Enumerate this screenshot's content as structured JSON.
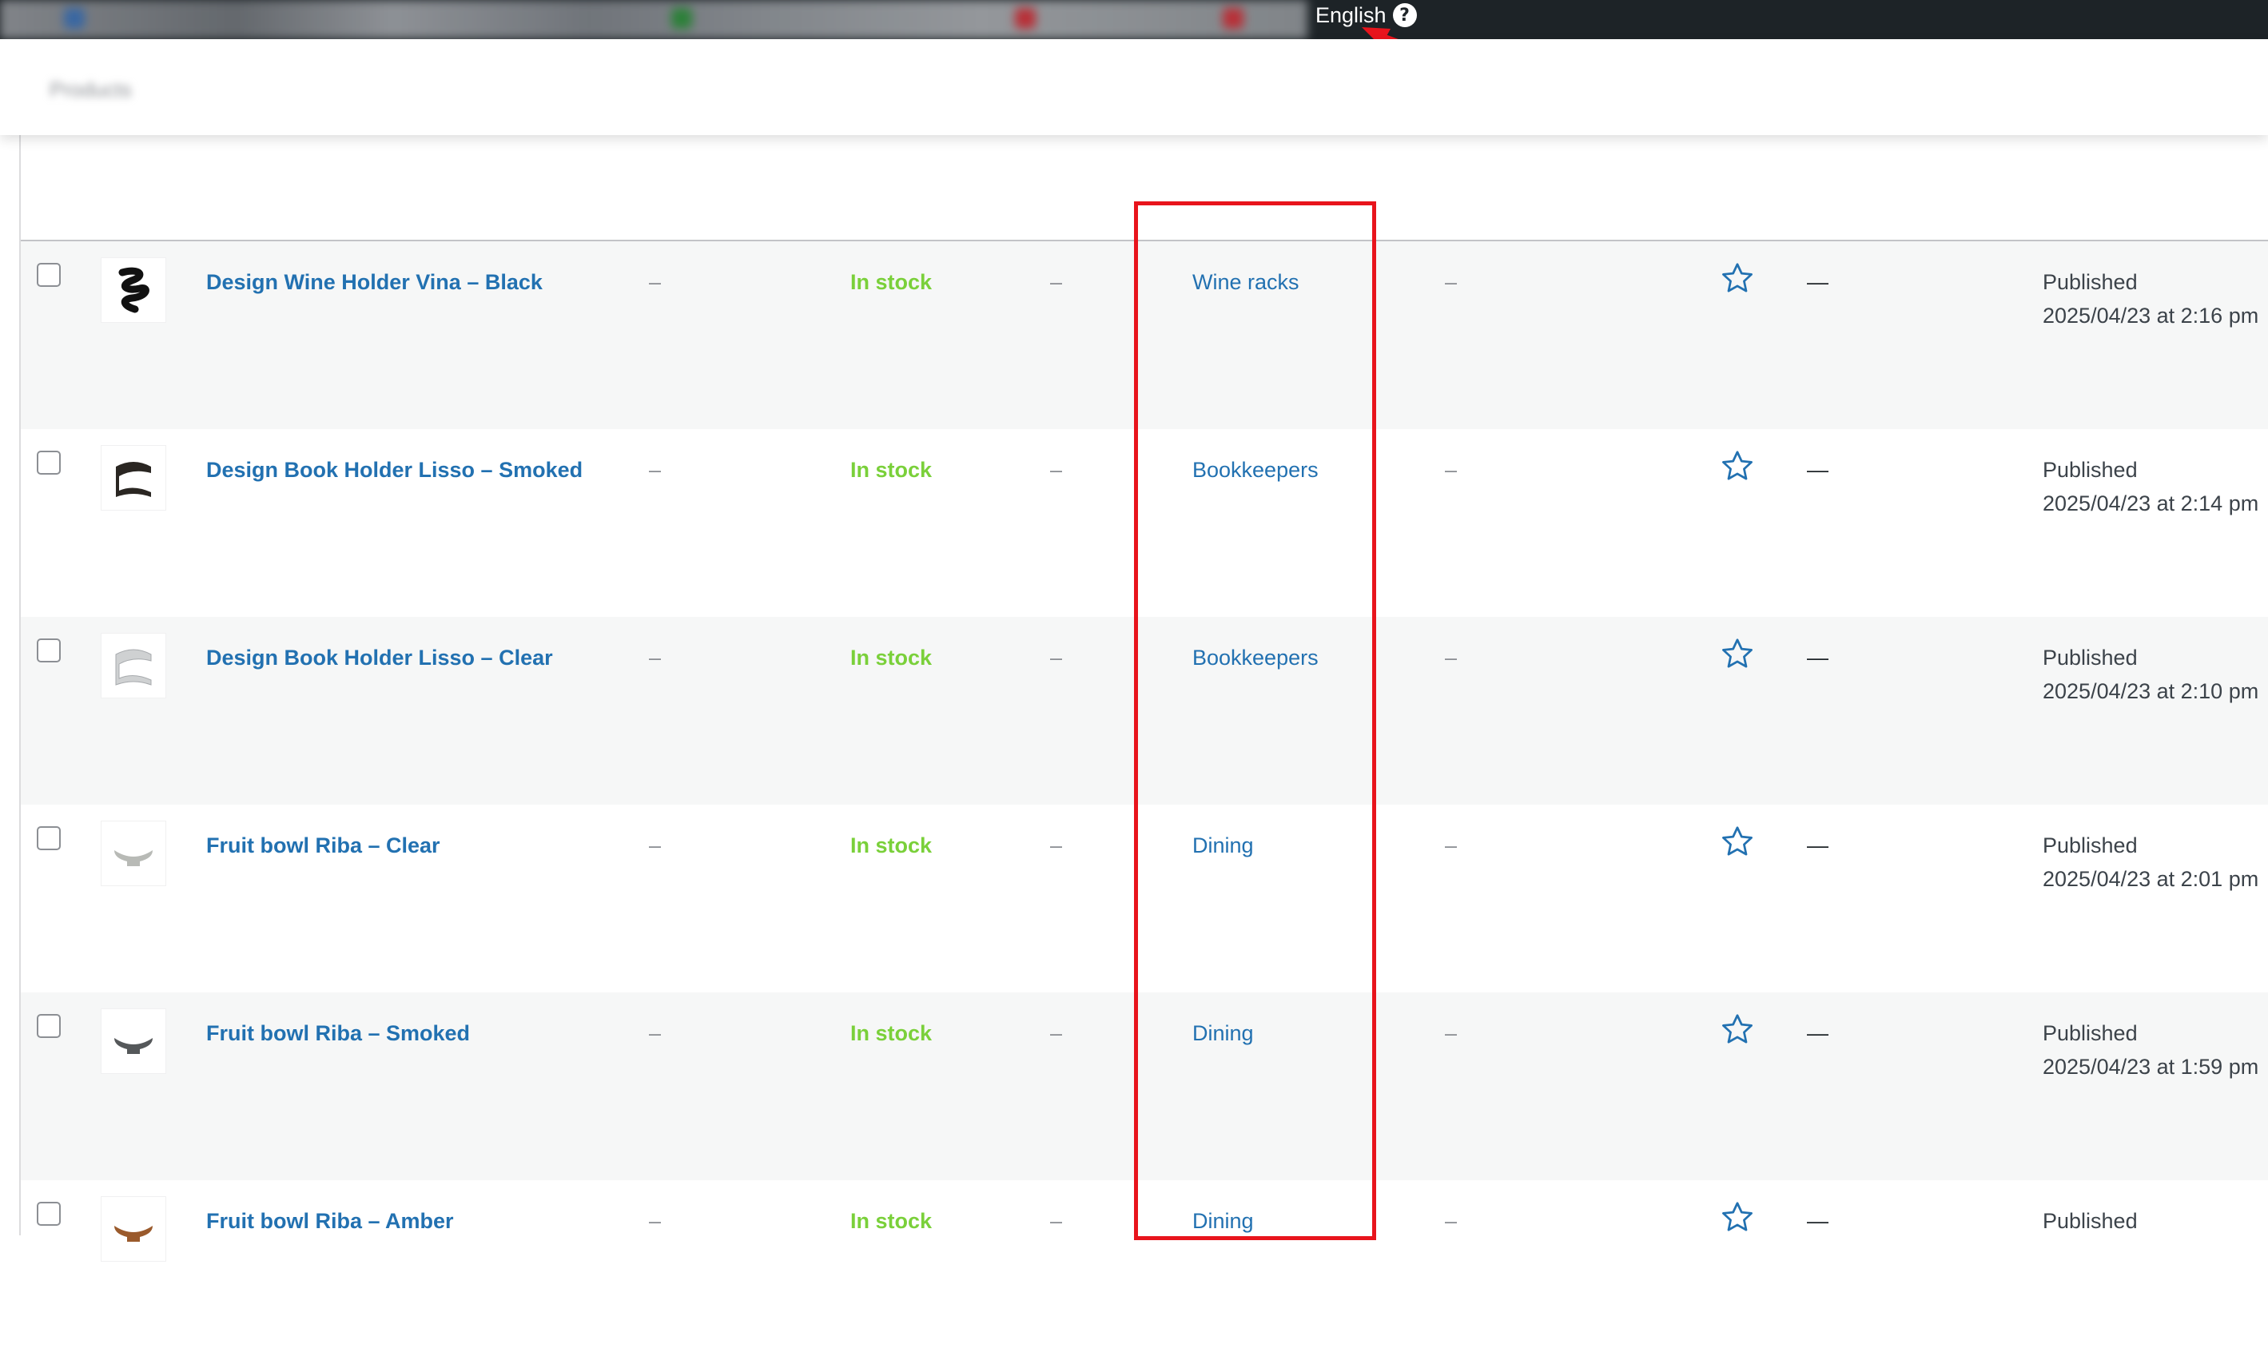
{
  "admin_bar": {
    "language_label": "English",
    "help_icon": "question-circle-icon"
  },
  "products": [
    {
      "name": "Design Wine Holder Vina – Black",
      "sku": "–",
      "stock": "In stock",
      "price": "–",
      "category": "Wine racks",
      "tags": "–",
      "featured_icon": "star-outline-icon",
      "type": "—",
      "status": "Published",
      "date": "2025/04/23 at 2:16 pm"
    },
    {
      "name": "Design Book Holder Lisso – Smoked",
      "sku": "–",
      "stock": "In stock",
      "price": "–",
      "category": "Bookkeepers",
      "tags": "–",
      "featured_icon": "star-outline-icon",
      "type": "—",
      "status": "Published",
      "date": "2025/04/23 at 2:14 pm"
    },
    {
      "name": "Design Book Holder Lisso – Clear",
      "sku": "–",
      "stock": "In stock",
      "price": "–",
      "category": "Bookkeepers",
      "tags": "–",
      "featured_icon": "star-outline-icon",
      "type": "—",
      "status": "Published",
      "date": "2025/04/23 at 2:10 pm"
    },
    {
      "name": "Fruit bowl Riba – Clear",
      "sku": "–",
      "stock": "In stock",
      "price": "–",
      "category": "Dining",
      "tags": "–",
      "featured_icon": "star-outline-icon",
      "type": "—",
      "status": "Published",
      "date": "2025/04/23 at 2:01 pm"
    },
    {
      "name": "Fruit bowl Riba – Smoked",
      "sku": "–",
      "stock": "In stock",
      "price": "–",
      "category": "Dining",
      "tags": "–",
      "featured_icon": "star-outline-icon",
      "type": "—",
      "status": "Published",
      "date": "2025/04/23 at 1:59 pm"
    },
    {
      "name": "Fruit bowl Riba – Amber",
      "sku": "–",
      "stock": "In stock",
      "price": "–",
      "category": "Dining",
      "tags": "–",
      "featured_icon": "star-outline-icon",
      "type": "—",
      "status": "Published",
      "date": ""
    }
  ],
  "colors": {
    "link": "#2271b1",
    "in_stock": "#7ad03a",
    "annotation": "#e8141c",
    "admin_bar": "#1d2327"
  }
}
